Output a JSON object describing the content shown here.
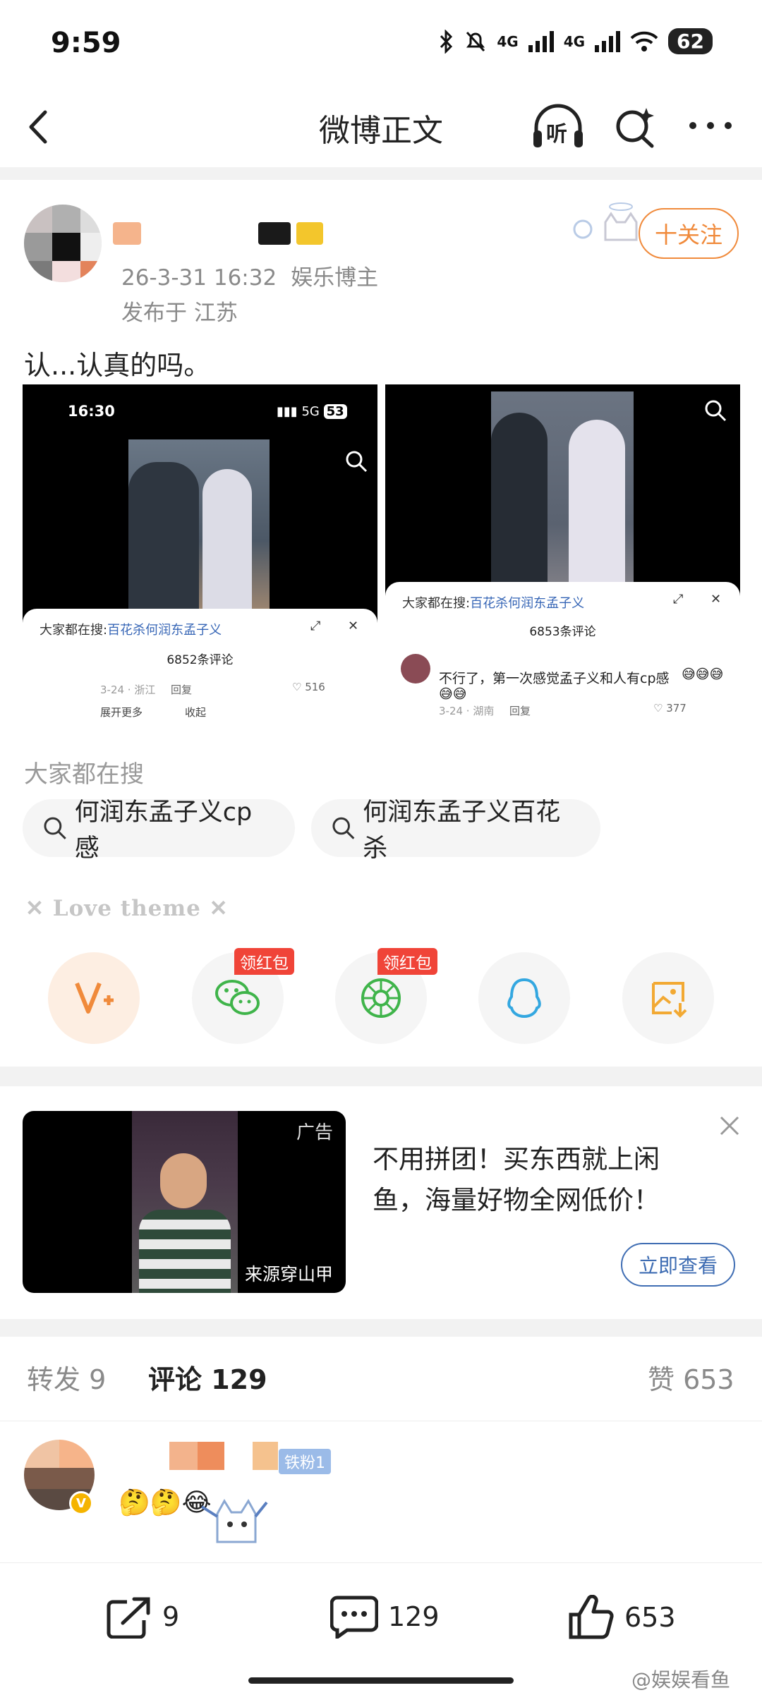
{
  "status_bar": {
    "time": "9:59",
    "network_1": "4G",
    "network_2": "4G",
    "battery": "62"
  },
  "nav": {
    "title": "微博正文",
    "listen_label": "听"
  },
  "post": {
    "timestamp": "26-3-31 16:32",
    "author_tag": "娱乐博主",
    "location": "发布于 江苏",
    "follow_label": "十关注",
    "text": "认...认真的吗。",
    "images": [
      {
        "status_time": "16:30",
        "network": "5G",
        "battery": "53",
        "search_prefix": "大家都在搜:",
        "search_term": "百花杀何润东孟子义",
        "comment_count": "6852条评论",
        "comment_meta": "3-24 · 浙江",
        "reply_label": "回复",
        "like_count": "516",
        "expand_label": "展开更多",
        "collapse_label": "收起"
      },
      {
        "search_prefix": "大家都在搜:",
        "search_term": "百花杀何润东孟子义",
        "comment_count": "6853条评论",
        "comment_text": "不行了，第一次感觉孟子义和人有cp感",
        "comment_meta": "3-24 · 湖南",
        "reply_label": "回复",
        "like_count": "377"
      }
    ]
  },
  "hot_search": {
    "title": "大家都在搜",
    "chips": [
      "何润东孟子义cp感",
      "何润东孟子义百花杀"
    ]
  },
  "love_theme": "Love theme",
  "share": {
    "items": [
      {
        "icon": "vplus-icon",
        "badge": ""
      },
      {
        "icon": "wechat-icon",
        "badge": "领红包"
      },
      {
        "icon": "moments-icon",
        "badge": "领红包"
      },
      {
        "icon": "qq-icon",
        "badge": ""
      },
      {
        "icon": "save-image-icon",
        "badge": ""
      }
    ]
  },
  "ad": {
    "label": "广告",
    "source": "来源穿山甲",
    "text": "不用拼团！买东西就上闲鱼，海量好物全网低价！",
    "cta": "立即查看"
  },
  "tabs": {
    "repost": "转发 9",
    "comment": "评论 129",
    "like": "赞 653"
  },
  "comment": {
    "fan_badge": "铁粉1",
    "emojis": "🤔🤔😂"
  },
  "bottom_bar": {
    "repost_count": "9",
    "comment_count": "129",
    "like_count": "653"
  },
  "watermark": "@娱娱看鱼",
  "colors": {
    "accent_orange": "#f08a3b",
    "link_blue": "#3f6db3",
    "redpack_red": "#f04438"
  }
}
